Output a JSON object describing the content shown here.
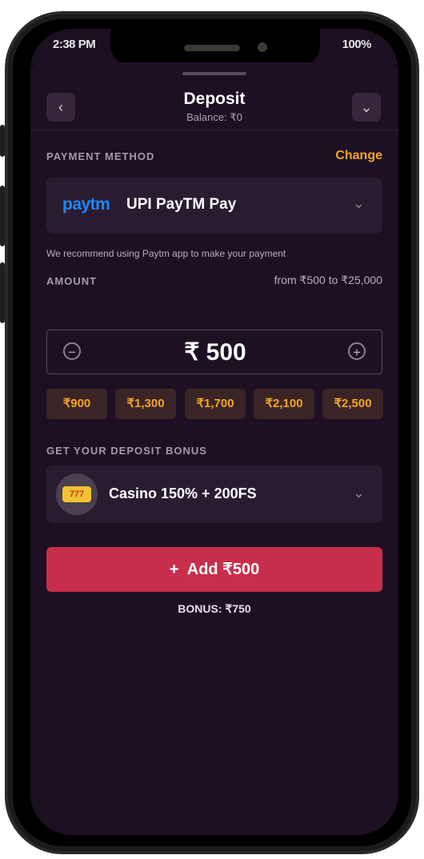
{
  "status": {
    "time": "2:38 PM",
    "battery": "100%"
  },
  "header": {
    "title": "Deposit",
    "balance": "Balance: ₹0"
  },
  "payment": {
    "label": "PAYMENT METHOD",
    "change": "Change",
    "logo": "paytm",
    "method": "UPI PayTM Pay",
    "note": "We recommend using Paytm app to make your payment"
  },
  "amount": {
    "label": "AMOUNT",
    "range": "from ₹500 to ₹25,000",
    "value": "₹ 500",
    "presets": [
      "₹900",
      "₹1,300",
      "₹1,700",
      "₹2,100",
      "₹2,500"
    ]
  },
  "bonus": {
    "label": "GET YOUR DEPOSIT BONUS",
    "name": "Casino 150% + 200FS",
    "slot_text": "777"
  },
  "actions": {
    "add_label": "Add ₹500",
    "plus": "+",
    "bonus_line": "BONUS: ₹750"
  },
  "icons": {
    "back": "chevron-left-icon",
    "collapse": "chevron-down-icon",
    "minus": "minus-circle-icon",
    "plus": "plus-circle-icon"
  },
  "colors": {
    "accent": "#f5a623",
    "cta": "#c72e4c",
    "background": "#1d1023"
  }
}
